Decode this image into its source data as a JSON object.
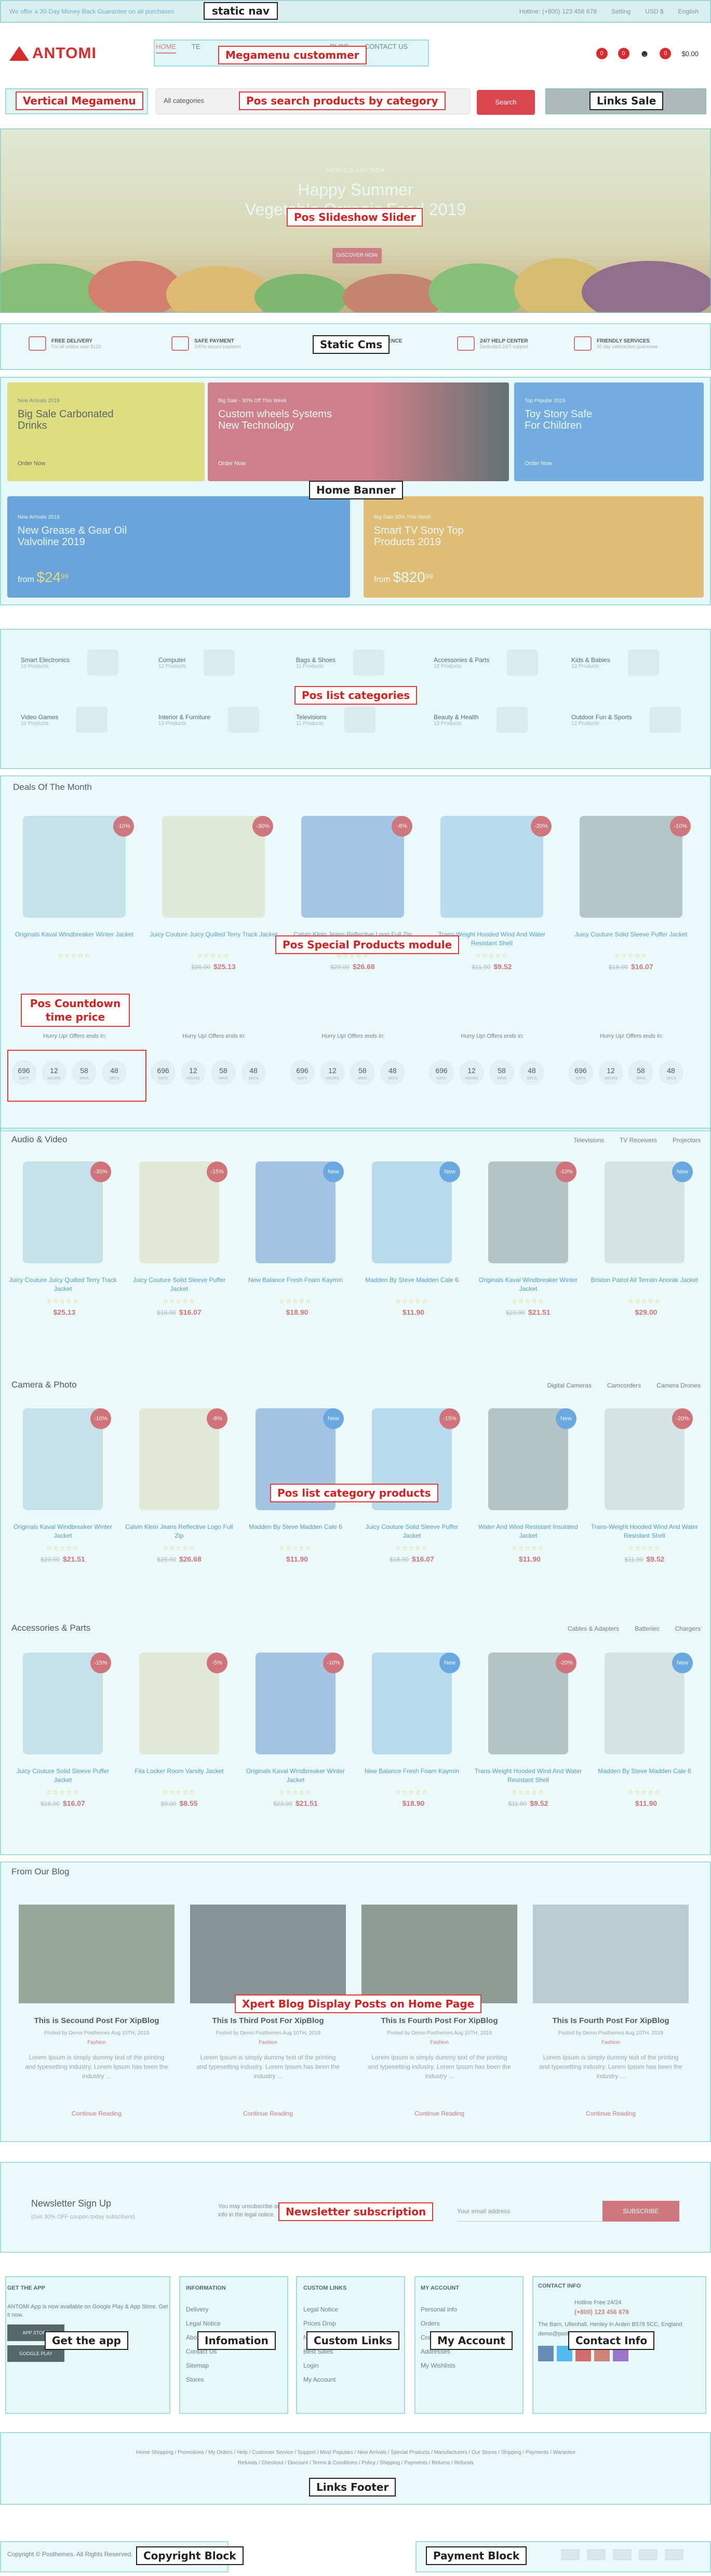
{
  "topbar": {
    "promo": "We offer a 30-Day Money Back Guarantee on all purchases",
    "hotline": "Hotline: (+800) 123 456 678",
    "setting": "Setting",
    "currency": "USD $",
    "language": "English"
  },
  "logo": {
    "text": "ANTOMI"
  },
  "menu": {
    "items": [
      "Home",
      "TE",
      "Blog",
      "Contact Us"
    ]
  },
  "header_icons": {
    "compare_count": "0",
    "wish_count": "0",
    "cart_count": "0",
    "cart_total": "$0.00"
  },
  "search": {
    "category": "All categories",
    "placeholder": "",
    "button": "Search"
  },
  "slider": {
    "kicker": "NEW COLLECTION",
    "line1": "Happy Summer",
    "line2": "Vegetable Organic Food 2019",
    "button": "DISCOVER NOW"
  },
  "services": [
    {
      "title": "FREE DELIVERY",
      "sub": "For all orders over $120"
    },
    {
      "title": "SAFE PAYMENT",
      "sub": "100% secure payment"
    },
    {
      "title": "SHOP WITH CONFIDENCE",
      "sub": "If goods have problems"
    },
    {
      "title": "24/7 HELP CENTER",
      "sub": "Dedicated 24/7 support"
    },
    {
      "title": "FRIENDLY SERVICES",
      "sub": "30 day satisfaction guarantee"
    }
  ],
  "banners": [
    {
      "small": "New Arrivals 2019",
      "title": "Big Sale Carbonated Drinks",
      "btn": "Order Now",
      "color": "#f2d648"
    },
    {
      "small": "Big Sale - 30% Off This Week",
      "title": "Custom wheels Systems New Technology",
      "btn": "Order Now",
      "color": "#d94556"
    },
    {
      "small": "Top Popular 2019",
      "title": "Toy Story Safe For Children",
      "btn": "Order Now",
      "color": "#4f8ad9"
    },
    {
      "small": "New Arrivals 2019",
      "title": "New Grease & Gear Oil Valvoline 2019",
      "price": "$24",
      "price_cents": "99",
      "prefix": "from",
      "color": "#3f7ed1"
    },
    {
      "small": "Big Sale 30% This Week",
      "title": "Smart TV Sony Top Products 2019",
      "price": "$820",
      "price_cents": "99",
      "prefix": "from",
      "color": "#f3a535"
    }
  ],
  "categories": [
    {
      "name": "Smart Electronics",
      "count": "10 Products"
    },
    {
      "name": "Computer",
      "count": "12 Products"
    },
    {
      "name": "Bags & Shoes",
      "count": "11 Products"
    },
    {
      "name": "Accessories & Parts",
      "count": "10 Products"
    },
    {
      "name": "Kids & Babies",
      "count": "13 Products"
    },
    {
      "name": "Video Games",
      "count": "10 Products"
    },
    {
      "name": "Interior & Furniture",
      "count": "13 Products"
    },
    {
      "name": "Televisions",
      "count": "11 Products"
    },
    {
      "name": "Beauty & Health",
      "count": "13 Products"
    },
    {
      "name": "Outdoor Fun & Sports",
      "count": "12 Products"
    }
  ],
  "deals": {
    "title": "Deals Of The Month",
    "hurry": "Hurry Up! Offers ends in:",
    "units": [
      "DAYS",
      "HOURS",
      "MINS",
      "SECS"
    ],
    "countdown": [
      "696",
      "12",
      "58",
      "48"
    ],
    "products": [
      {
        "name": "Originals Kaval Windbreaker Winter Jacket",
        "badge": "-10%",
        "old": "",
        "price": ""
      },
      {
        "name": "Juicy Couture Juicy Quilted Terry Track Jacket",
        "badge": "-30%",
        "old": "$36.00",
        "price": "$25.13"
      },
      {
        "name": "Calvin Klein Jeans Reflective Logo Full Zip",
        "badge": "-8%",
        "old": "$29.00",
        "price": "$26.68"
      },
      {
        "name": "Trans-Weight Hooded Wind And Water Resistant Shell",
        "badge": "-20%",
        "old": "$11.90",
        "price": "$9.52"
      },
      {
        "name": "Juicy Couture Solid Sleeve Puffer Jacket",
        "badge": "-10%",
        "old": "$18.90",
        "price": "$16.07"
      }
    ]
  },
  "audio": {
    "title": "Audio & Video",
    "tabs": [
      "Televisions",
      "TV Receivers",
      "Projectors"
    ],
    "products": [
      {
        "name": "Juicy Couture Juicy Quilted Terry Track Jacket",
        "badge": "-30%",
        "old": "",
        "price": "$25.13"
      },
      {
        "name": "Juicy Couture Solid Sleeve Puffer Jacket",
        "badge": "-15%",
        "old": "$18.90",
        "price": "$16.07"
      },
      {
        "name": "New Balance Fresh Foam Kaymin",
        "badge": "New",
        "old": "",
        "price": "$18.90"
      },
      {
        "name": "Madden By Steve Madden Cale 6",
        "badge": "New",
        "old": "",
        "price": "$11.90"
      },
      {
        "name": "Originals Kaval Windbreaker Winter Jacket",
        "badge": "-10%",
        "old": "$23.90",
        "price": "$21.51"
      },
      {
        "name": "Brixton Patrol All Terrain Anorak Jacket",
        "badge": "New",
        "old": "",
        "price": "$29.00"
      }
    ]
  },
  "camera": {
    "title": "Camera & Photo",
    "tabs": [
      "Digital Cameras",
      "Camcorders",
      "Camera Drones"
    ],
    "products": [
      {
        "name": "Originals Kaval Windbreaker Winter Jacket",
        "badge": "-10%",
        "old": "$23.90",
        "price": "$21.51"
      },
      {
        "name": "Calvin Klein Jeans Reflective Logo Full Zip",
        "badge": "-8%",
        "old": "$29.00",
        "price": "$26.68"
      },
      {
        "name": "Madden By Steve Madden Cale 6",
        "badge": "New",
        "old": "",
        "price": "$11.90"
      },
      {
        "name": "Juicy Couture Solid Sleeve Puffer Jacket",
        "badge": "-15%",
        "old": "$18.90",
        "price": "$16.07"
      },
      {
        "name": "Water And Wind Resistant Insulated Jacket",
        "badge": "New",
        "old": "",
        "price": "$11.90"
      },
      {
        "name": "Trans-Weight Hooded Wind And Water Resistant Shell",
        "badge": "-20%",
        "old": "$11.90",
        "price": "$9.52"
      }
    ]
  },
  "accessories": {
    "title": "Accessories & Parts",
    "tabs": [
      "Cables & Adapters",
      "Batteries",
      "Chargers"
    ],
    "products": [
      {
        "name": "Juicy Couture Solid Sleeve Puffer Jacket",
        "badge": "-15%",
        "old": "$18.90",
        "price": "$16.07"
      },
      {
        "name": "Fila Locker Room Varsity Jacket",
        "badge": "-5%",
        "old": "$9.00",
        "price": "$8.55"
      },
      {
        "name": "Originals Kaval Windbreaker Winter Jacket",
        "badge": "-10%",
        "old": "$23.90",
        "price": "$21.51"
      },
      {
        "name": "New Balance Fresh Foam Kaymin",
        "badge": "New",
        "old": "",
        "price": "$18.90"
      },
      {
        "name": "Trans-Weight Hooded Wind And Water Resistant Shell",
        "badge": "-20%",
        "old": "$11.90",
        "price": "$9.52"
      },
      {
        "name": "Madden By Steve Madden Cale 6",
        "badge": "New",
        "old": "",
        "price": "$11.90"
      }
    ]
  },
  "blog": {
    "title": "From Our Blog",
    "read": "Continue Reading",
    "excerpt": "Lorem Ipsum is simply dummy text of the printing and typesetting industry. Lorem Ipsum has been the industry ...",
    "tag": "Fashion",
    "posts": [
      {
        "title": "This is Secound Post For XipBlog",
        "meta": "Posted by Demo Posthemes Aug 10TH, 2019"
      },
      {
        "title": "This Is Third Post For XipBlog",
        "meta": "Posted by Demo Posthemes Aug 10TH, 2019"
      },
      {
        "title": "This Is Fourth Post For XipBlog",
        "meta": "Posted by Demo Posthemes Aug 10TH, 2019"
      },
      {
        "title": "This Is Fourth Post For XipBlog",
        "meta": "Posted by Demo Posthemes Aug 10TH, 2019"
      }
    ]
  },
  "newsletter": {
    "title": "Newsletter Sign Up",
    "sub": "(Get 30% OFF coupon today subscibers)",
    "may": "You may unsubscribe at any moment. For that purpose, please find our contact info in the legal notice.",
    "placeholder": "Your email address",
    "button": "Subscribe"
  },
  "footer": {
    "app": {
      "title": "Get The App",
      "text": "ANTOMI App is now available on Google Play & App Store. Get it now.",
      "store1": "APP STORE",
      "store2": "GOOGLE PLAY"
    },
    "info": {
      "title": "Information",
      "links": [
        "Delivery",
        "Legal Notice",
        "About Us",
        "Contact Us",
        "Sitemap",
        "Stores"
      ]
    },
    "custom": {
      "title": "Custom Links",
      "links": [
        "Legal Notice",
        "Prices Drop",
        "New Products",
        "Best Sales",
        "Login",
        "My Account"
      ]
    },
    "account": {
      "title": "My Account",
      "links": [
        "Personal info",
        "Orders",
        "Credit slips",
        "Addresses",
        "My Wishlists"
      ]
    },
    "contact": {
      "title": "Contact Info",
      "hotline": "Hotline Free 24/24",
      "phone": "(+800) 123 456 678",
      "addr": "The Barn, Ullenhall, Henley in Arden B578 5CC, England",
      "email": "demo@posthemes.com"
    },
    "links1": "Home Shopping / Promotions / My Orders / Help / Customer Service / Support / Most Populars / New Arrivals / Special Products / Manufacturers / Our Stores / Shipping / Payments / Warantee",
    "links2": "Refunds / Checkout / Discount / Terms & Conditions / Policy / Shipping / Payments / Returns / Refunds",
    "copyright": "Copyright © Posthemes. All Rights Reserved."
  },
  "labels": {
    "static_nav": "static nav",
    "megamenu": "Megamenu custommer",
    "vertical": "Vertical Megamenu",
    "search": "Pos search products by category",
    "links_sale": "Links Sale",
    "slideshow": "Pos Slideshow Slider",
    "static_cms": "Static Cms",
    "home_banner": "Home Banner",
    "list_categories": "Pos list categories",
    "special": "Pos Special Products module",
    "countdown": "Pos Countdown time price",
    "list_category_products": "Pos list category products",
    "blog": "Xpert Blog Display Posts on Home Page",
    "newsletter": "Newsletter subscription",
    "get_app": "Get the app",
    "infomation": "Infomation",
    "custom_links": "Custom Links",
    "my_account": "My Account",
    "contact_info": "Contact Info",
    "links_footer": "Links Footer",
    "copyright_block": "Copyright Block",
    "payment_block": "Payment Block"
  },
  "colors": {
    "accent": "#d9464f",
    "link": "#2a7ec4",
    "overlay": "#baebeb"
  }
}
